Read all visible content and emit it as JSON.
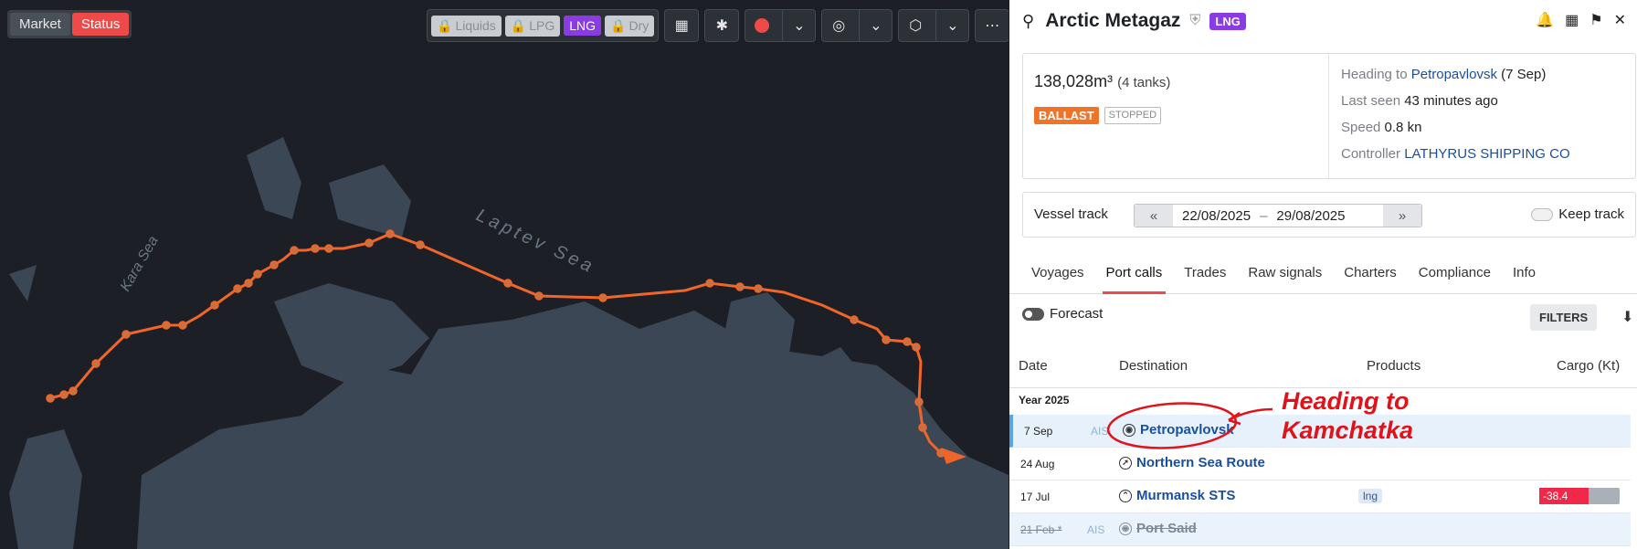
{
  "map": {
    "segmented": [
      "Market",
      "Status"
    ],
    "chips": [
      {
        "label": "Liquids",
        "locked": true
      },
      {
        "label": "LPG",
        "locked": true
      },
      {
        "label": "LNG",
        "locked": false
      },
      {
        "label": "Dry",
        "locked": true
      }
    ],
    "labels": {
      "kara": "Kara Sea",
      "laptev": "Laptev Sea"
    }
  },
  "vessel": {
    "name": "Arctic Metagaz",
    "type_badge": "LNG",
    "capacity": "138,028m³",
    "tanks": "(4 tanks)",
    "status_badge": "BALLAST",
    "motion_badge": "STOPPED",
    "heading_label": "Heading to",
    "heading_port": "Petropavlovsk",
    "heading_date": "(7 Sep)",
    "last_seen_label": "Last seen",
    "last_seen": "43 minutes ago",
    "speed_label": "Speed",
    "speed": "0.8 kn",
    "controller_label": "Controller",
    "controller": "LATHYRUS SHIPPING CO"
  },
  "track": {
    "label": "Vessel track",
    "from": "22/08/2025",
    "sep": "–",
    "to": "29/08/2025",
    "keep": "Keep track"
  },
  "tabs": [
    "Voyages",
    "Port calls",
    "Trades",
    "Raw signals",
    "Charters",
    "Compliance",
    "Info"
  ],
  "list": {
    "forecast": "Forecast",
    "filters": "FILTERS",
    "headers": {
      "date": "Date",
      "dest": "Destination",
      "products": "Products",
      "cargo": "Cargo (Kt)"
    },
    "year": "Year 2025",
    "rows": [
      {
        "date": "7 Sep",
        "ais": "AIS",
        "dest": "Petropavlovsk",
        "product": "",
        "cargo": ""
      },
      {
        "date": "24 Aug",
        "ais": "",
        "dest": "Northern Sea Route",
        "product": "",
        "cargo": ""
      },
      {
        "date": "17 Jul",
        "ais": "",
        "dest": "Murmansk STS",
        "product": "lng",
        "cargo": "-38.4"
      },
      {
        "date": "21 Feb *",
        "ais": "AIS",
        "dest": "Port Said",
        "product": "",
        "cargo": ""
      }
    ]
  },
  "annotation": {
    "line1": "Heading to",
    "line2": "Kamchatka"
  }
}
